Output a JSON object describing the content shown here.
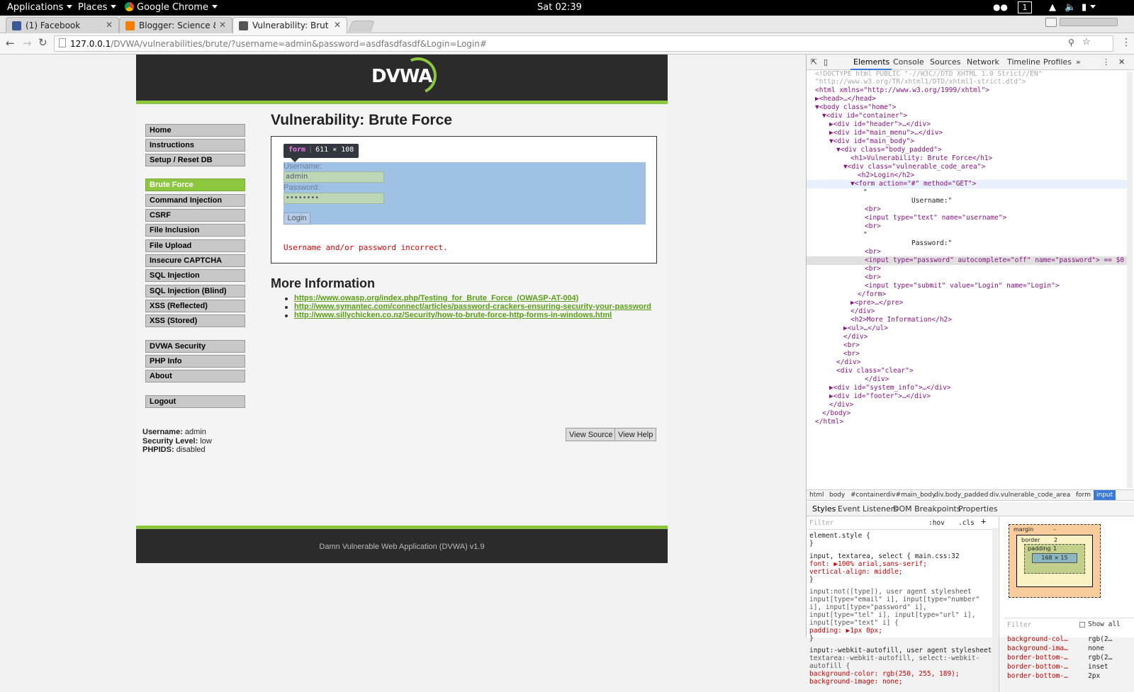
{
  "topbar": {
    "applications": "Applications",
    "places": "Places",
    "app_name": "Google Chrome",
    "clock": "Sat 02:39",
    "workspace": "1"
  },
  "browser": {
    "tabs": [
      {
        "title": "(1) Facebook",
        "favicon_color": "#3b5998"
      },
      {
        "title": "Blogger: Science &",
        "favicon_color": "#f57d00"
      },
      {
        "title": "Vulnerability: Brute",
        "favicon_color": "#555555"
      }
    ],
    "url_host": "127.0.0.1",
    "url_path": "/DVWA/vulnerabilities/brute/?username=admin&password=asdfasdfasdf&Login=Login#"
  },
  "dvwa": {
    "logo": "DVWA",
    "menu_group1": [
      "Home",
      "Instructions",
      "Setup / Reset DB"
    ],
    "menu_group2": [
      "Brute Force",
      "Command Injection",
      "CSRF",
      "File Inclusion",
      "File Upload",
      "Insecure CAPTCHA",
      "SQL Injection",
      "SQL Injection (Blind)",
      "XSS (Reflected)",
      "XSS (Stored)"
    ],
    "menu_group3": [
      "DVWA Security",
      "PHP Info",
      "About"
    ],
    "menu_group4": [
      "Logout"
    ],
    "selected_menu": "Brute Force",
    "title": "Vulnerability: Brute Force",
    "tooltip_tag": "form",
    "tooltip_size": "611 × 108",
    "form": {
      "username_label": "Username:",
      "username_value": "admin",
      "password_label": "Password:",
      "password_value": "••••••••",
      "login_button": "Login"
    },
    "error": "Username and/or password incorrect.",
    "more_info_title": "More Information",
    "links": [
      "https://www.owasp.org/index.php/Testing_for_Brute_Force_(OWASP-AT-004)",
      "http://www.symantec.com/connect/articles/password-crackers-ensuring-security-your-password",
      "http://www.sillychicken.co.nz/Security/how-to-brute-force-http-forms-in-windows.html"
    ],
    "user_info": {
      "username_label": "Username:",
      "username": "admin",
      "security_label": "Security Level:",
      "security": "low",
      "phpids_label": "PHPIDS:",
      "phpids": "disabled"
    },
    "view_source": "View Source",
    "view_help": "View Help",
    "footer": "Damn Vulnerable Web Application (DVWA) v1.9"
  },
  "devtools": {
    "tabs": [
      "Elements",
      "Console",
      "Sources",
      "Network",
      "Timeline",
      "Profiles",
      "»"
    ],
    "dom_lines": [
      "<!DOCTYPE html PUBLIC \"-//W3C//DTD XHTML 1.0 Strict//EN\"",
      "\"http://www.w3.org/TR/xhtml1/DTD/xhtml1-strict.dtd\">",
      "<html xmlns=\"http://www.w3.org/1999/xhtml\">",
      "▶<head>…</head>",
      "▼<body class=\"home\">",
      "▼<div id=\"container\">",
      "▶<div id=\"header\">…</div>",
      "▶<div id=\"main_menu\">…</div>",
      "▼<div id=\"main_body\">",
      "▼<div class=\"body_padded\">",
      "<h1>Vulnerability: Brute Force</h1>",
      "▼<div class=\"vulnerable_code_area\">",
      "<h2>Login</h2>",
      "▼<form action=\"#\" method=\"GET\">",
      "\"",
      "Username:\"",
      "<br>",
      "<input type=\"text\" name=\"username\">",
      "<br>",
      "\"",
      "Password:\"",
      "<br>",
      "<input type=\"password\" autocomplete=\"off\" name=\"password\"> == $0",
      "<br>",
      "<br>",
      "<input type=\"submit\" value=\"Login\" name=\"Login\">",
      "</form>",
      "▶<pre>…</pre>",
      "</div>",
      "<h2>More Information</h2>",
      "▶<ul>…</ul>",
      "</div>",
      "<br>",
      "<br>",
      "</div>",
      "<div class=\"clear\">",
      "</div>",
      "▶<div id=\"system_info\">…</div>",
      "▶<div id=\"footer\">…</div>",
      "</div>",
      "</body>",
      "</html>"
    ],
    "breadcrumbs": [
      "html",
      "body",
      "#container",
      "div#main_body",
      "div.body_padded",
      "div.vulnerable_code_area",
      "form",
      "input"
    ],
    "subtabs": [
      "Styles",
      "Event Listeners",
      "DOM Breakpoints",
      "Properties"
    ],
    "filter_placeholder": "Filter",
    "hov": ":hov",
    "cls": ".cls",
    "style_lines": [
      "element.style {",
      "}",
      "input, textarea, select {        main.css:32",
      "  font: ▶100% arial,sans-serif;",
      "  vertical-align: middle;",
      "}",
      "input:not([type]),      user agent stylesheet",
      "input[type=\"email\" i], input[type=\"number\"",
      "i], input[type=\"password\" i],",
      "input[type=\"tel\" i], input[type=\"url\" i],",
      "input[type=\"text\" i] {",
      "  padding: ▶1px 0px;",
      "}",
      "input:-webkit-autofill,  user agent stylesheet",
      "textarea:-webkit-autofill, select:-webkit-",
      "autofill {",
      "  background-color: rgb(250, 255, 189);",
      "  background-image: none;"
    ],
    "box_model": {
      "margin_label": "margin",
      "margin": "–",
      "border_label": "border",
      "border": "2",
      "padding_label": "padding",
      "padding": "1",
      "content": "168 × 15"
    },
    "computed_filter": "Filter",
    "show_all": "Show all",
    "computed": [
      {
        "prop": "background-col…",
        "val": "rgb(2…"
      },
      {
        "prop": "background-ima…",
        "val": "none"
      },
      {
        "prop": "border-bottom-…",
        "val": "rgb(2…"
      },
      {
        "prop": "border-bottom-…",
        "val": "inset"
      },
      {
        "prop": "border-bottom-…",
        "val": "2px"
      }
    ]
  }
}
